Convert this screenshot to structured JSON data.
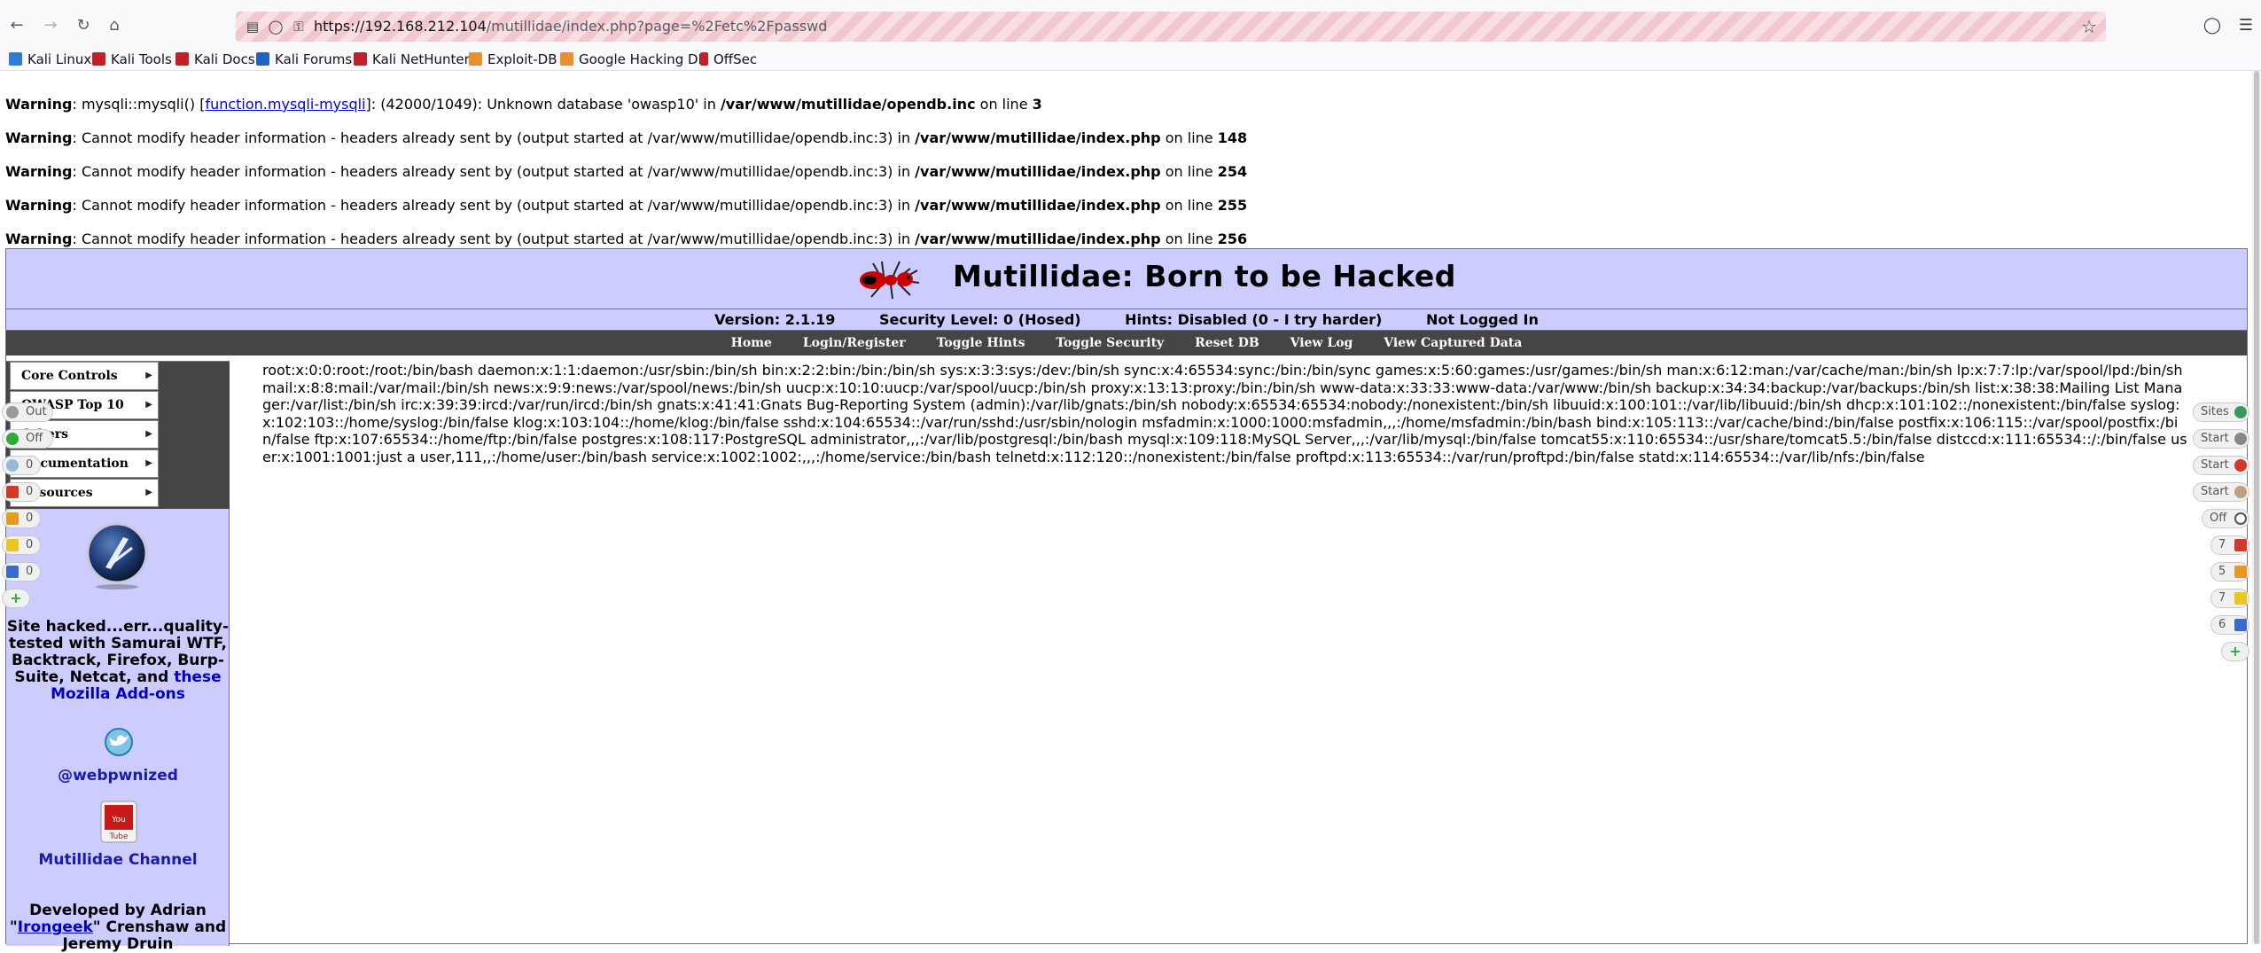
{
  "browser": {
    "url_host": "https://192.168.212.104",
    "url_path": "/mutillidae/index.php?page=%2Fetc%2Fpasswd",
    "bookmarks": [
      {
        "label": "Kali Linux",
        "color": "#2d7bd8"
      },
      {
        "label": "Kali Tools",
        "color": "#c41f2b"
      },
      {
        "label": "Kali Docs",
        "color": "#c41f2b"
      },
      {
        "label": "Kali Forums",
        "color": "#1f63c4"
      },
      {
        "label": "Kali NetHunter",
        "color": "#c41f2b"
      },
      {
        "label": "Exploit-DB",
        "color": "#e8902a"
      },
      {
        "label": "Google Hacking DB",
        "color": "#e8902a"
      },
      {
        "label": "OffSec",
        "color": "#c41f2b"
      }
    ]
  },
  "warnings": [
    {
      "label": "Warning",
      "pre": ": mysqli::mysqli() [",
      "link": "function.mysqli-mysqli",
      "post": "]: (42000/1049): Unknown database 'owasp10' in ",
      "file": "/var/www/mutillidae/opendb.inc",
      "on": " on line ",
      "line": "3"
    },
    {
      "label": "Warning",
      "pre": ": Cannot modify header information - headers already sent by (output started at /var/www/mutillidae/opendb.inc:3) in ",
      "file": "/var/www/mutillidae/index.php",
      "on": " on line ",
      "line": "148"
    },
    {
      "label": "Warning",
      "pre": ": Cannot modify header information - headers already sent by (output started at /var/www/mutillidae/opendb.inc:3) in ",
      "file": "/var/www/mutillidae/index.php",
      "on": " on line ",
      "line": "254"
    },
    {
      "label": "Warning",
      "pre": ": Cannot modify header information - headers already sent by (output started at /var/www/mutillidae/opendb.inc:3) in ",
      "file": "/var/www/mutillidae/index.php",
      "on": " on line ",
      "line": "255"
    },
    {
      "label": "Warning",
      "pre": ": Cannot modify header information - headers already sent by (output started at /var/www/mutillidae/opendb.inc:3) in ",
      "file": "/var/www/mutillidae/index.php",
      "on": " on line ",
      "line": "256"
    }
  ],
  "site": {
    "title": "Mutillidae: Born to be Hacked",
    "version": "Version: 2.1.19",
    "security": "Security Level: 0 (Hosed)",
    "hints": "Hints: Disabled (0 - I try harder)",
    "login_status": "Not Logged In"
  },
  "menu": [
    "Home",
    "Login/Register",
    "Toggle Hints",
    "Toggle Security",
    "Reset DB",
    "View Log",
    "View Captured Data"
  ],
  "sidemenu": [
    "Core Controls",
    "OWASP Top 10",
    "Others",
    "Documentation",
    "Resources"
  ],
  "sidebar": {
    "hacked_text_1": "Site hacked...err...quality-tested with Samurai WTF, Backtrack, Firefox, Burp-Suite, Netcat, and",
    "hacked_link": "these Mozilla Add-ons",
    "twitter": "@webpwnized",
    "youtube": "Mutillidae Channel",
    "dev_1": "Developed by Adrian",
    "dev_q1": "\"",
    "dev_link": "Irongeek",
    "dev_q2": "\" Crenshaw and",
    "dev_2": "Jeremy Druin"
  },
  "passwd_text": "root:x:0:0:root:/root:/bin/bash daemon:x:1:1:daemon:/usr/sbin:/bin/sh bin:x:2:2:bin:/bin:/bin/sh sys:x:3:3:sys:/dev:/bin/sh sync:x:4:65534:sync:/bin:/bin/sync games:x:5:60:games:/usr/games:/bin/sh man:x:6:12:man:/var/cache/man:/bin/sh lp:x:7:7:lp:/var/spool/lpd:/bin/sh mail:x:8:8:mail:/var/mail:/bin/sh news:x:9:9:news:/var/spool/news:/bin/sh uucp:x:10:10:uucp:/var/spool/uucp:/bin/sh proxy:x:13:13:proxy:/bin:/bin/sh www-data:x:33:33:www-data:/var/www:/bin/sh backup:x:34:34:backup:/var/backups:/bin/sh list:x:38:38:Mailing List Manager:/var/list:/bin/sh irc:x:39:39:ircd:/var/run/ircd:/bin/sh gnats:x:41:41:Gnats Bug-Reporting System (admin):/var/lib/gnats:/bin/sh nobody:x:65534:65534:nobody:/nonexistent:/bin/sh libuuid:x:100:101::/var/lib/libuuid:/bin/sh dhcp:x:101:102::/nonexistent:/bin/false syslog:x:102:103::/home/syslog:/bin/false klog:x:103:104::/home/klog:/bin/false sshd:x:104:65534::/var/run/sshd:/usr/sbin/nologin msfadmin:x:1000:1000:msfadmin,,,:/home/msfadmin:/bin/bash bind:x:105:113::/var/cache/bind:/bin/false postfix:x:106:115::/var/spool/postfix:/bin/false ftp:x:107:65534::/home/ftp:/bin/false postgres:x:108:117:PostgreSQL administrator,,,:/var/lib/postgresql:/bin/bash mysql:x:109:118:MySQL Server,,,:/var/lib/mysql:/bin/false tomcat55:x:110:65534::/usr/share/tomcat5.5:/bin/false distccd:x:111:65534::/:/bin/false user:x:1001:1001:just a user,111,,:/home/user:/bin/bash service:x:1002:1002:,,,:/home/service:/bin/bash telnetd:x:112:120::/nonexistent:/bin/false proftpd:x:113:65534::/var/run/proftpd:/bin/false statd:x:114:65534::/var/lib/nfs:/bin/false",
  "left_pills": [
    "Out",
    "Off",
    "0",
    "0",
    "0",
    "0",
    "0"
  ],
  "right_pills": [
    "Sites",
    "Start",
    "Start",
    "Start",
    "Off",
    "7",
    "5",
    "7",
    "6"
  ]
}
